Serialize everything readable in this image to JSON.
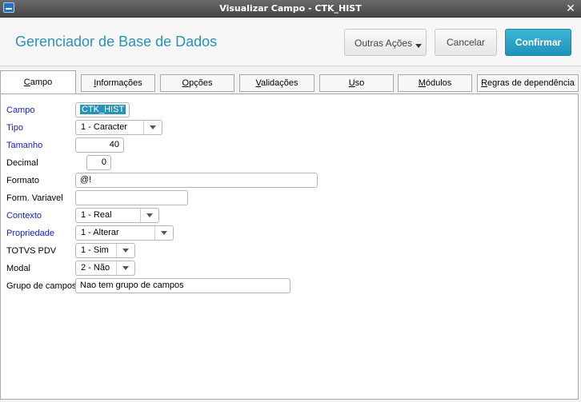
{
  "window": {
    "title": "Visualizar Campo - CTK_HIST",
    "close_icon": "✕"
  },
  "header": {
    "app_title": "Gerenciador de Base de Dados"
  },
  "toolbar": {
    "outras_acoes": "Outras Ações",
    "cancelar": "Cancelar",
    "confirmar": "Confirmar"
  },
  "tabs": [
    {
      "pre": "",
      "key": "C",
      "post": "ampo"
    },
    {
      "pre": "",
      "key": "I",
      "post": "nformações"
    },
    {
      "pre": "",
      "key": "O",
      "post": "pções"
    },
    {
      "pre": "",
      "key": "V",
      "post": "alidações"
    },
    {
      "pre": "",
      "key": "U",
      "post": "so"
    },
    {
      "pre": "",
      "key": "M",
      "post": "ódulos"
    },
    {
      "pre": "",
      "key": "R",
      "post": "egras de dependência"
    }
  ],
  "form": {
    "campo": {
      "label": "Campo",
      "value": "CTK_HIST"
    },
    "tipo": {
      "label": "Tipo",
      "value": "1 - Caracter"
    },
    "tamanho": {
      "label": "Tamanho",
      "value": "40"
    },
    "decimal": {
      "label": "Decimal",
      "value": "0"
    },
    "formato": {
      "label": "Formato",
      "value": "@!"
    },
    "form_variavel": {
      "label": "Form. Variavel",
      "value": ""
    },
    "contexto": {
      "label": "Contexto",
      "value": "1 - Real"
    },
    "propriedade": {
      "label": "Propriedade",
      "value": "1 - Alterar"
    },
    "totvs_pdv": {
      "label": "TOTVS PDV",
      "value": "1 - Sim"
    },
    "modal": {
      "label": "Modal",
      "value": "2 - Não"
    },
    "grupo_campos": {
      "label": "Grupo de campos",
      "value": "Nao tem grupo de campos"
    }
  },
  "colors": {
    "accent": "#2a93b5",
    "required_label": "#1522c9",
    "titlebar": "#555555"
  }
}
